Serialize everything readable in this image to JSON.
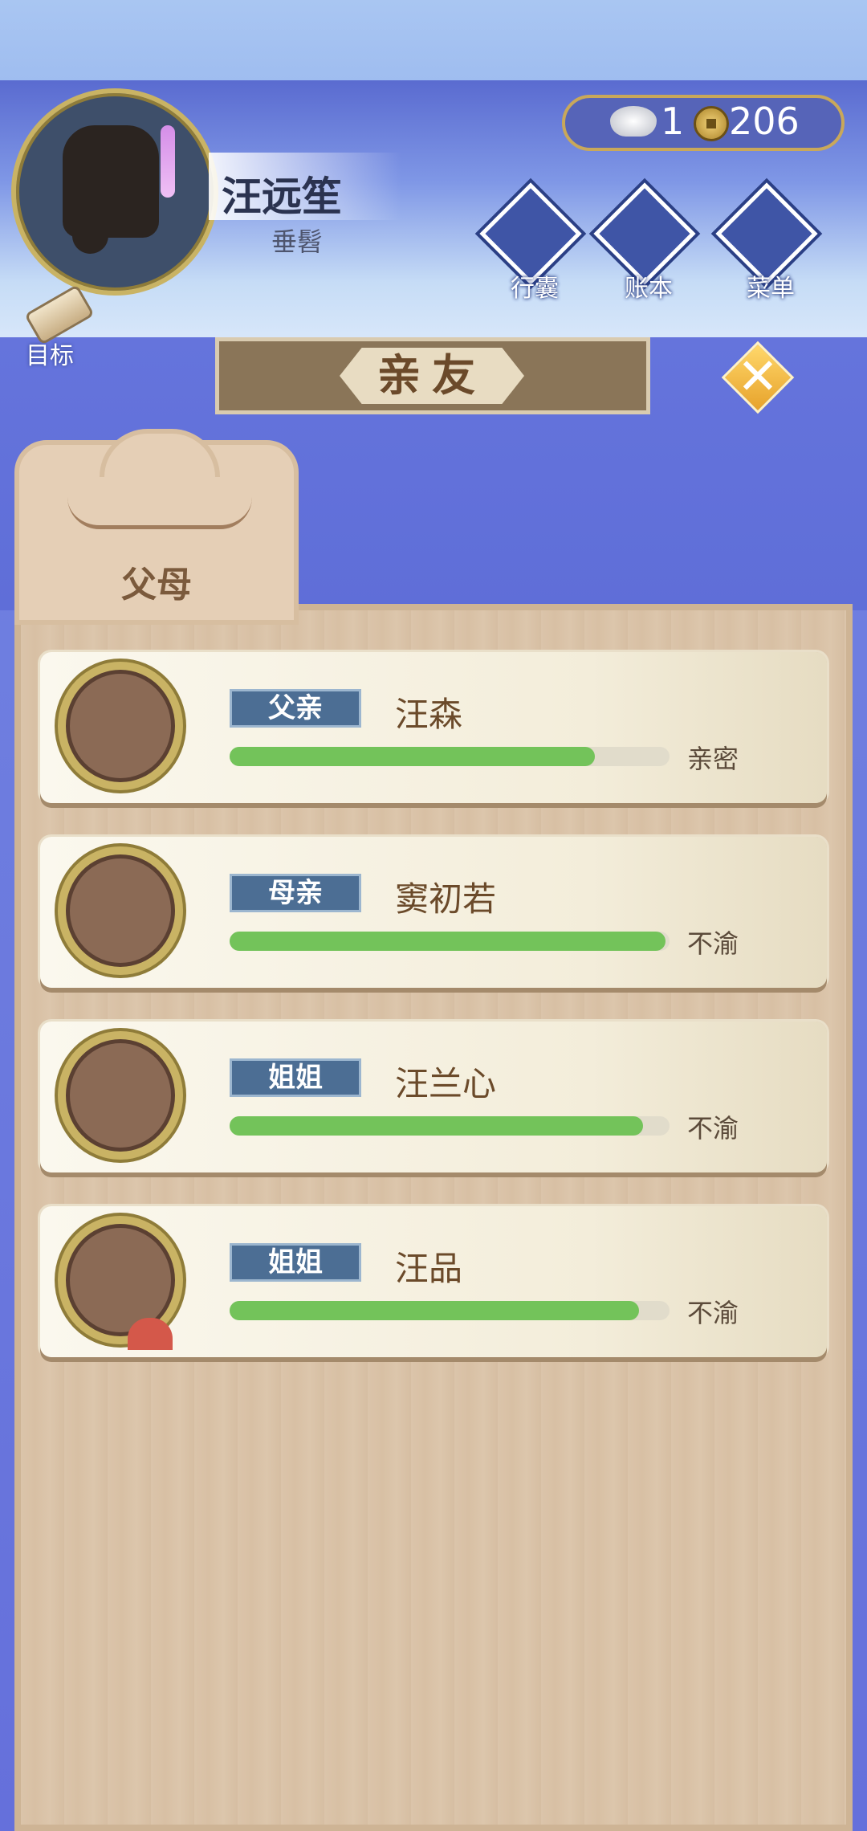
{
  "player": {
    "name": "汪远笙",
    "title": "垂髫"
  },
  "currency": {
    "silver": "1",
    "copper": "206"
  },
  "top_buttons": [
    {
      "label": "行囊",
      "icon": "bag-icon"
    },
    {
      "label": "账本",
      "icon": "ledger-icon"
    },
    {
      "label": "菜单",
      "icon": "menu-dots-icon"
    }
  ],
  "goal": {
    "label": "目标"
  },
  "page_title": "亲友",
  "tab": {
    "label": "父母"
  },
  "relatives": [
    {
      "relation": "父亲",
      "name": "汪森",
      "status": "亲密",
      "affinity": 0.83
    },
    {
      "relation": "母亲",
      "name": "窦初若",
      "status": "不渝",
      "affinity": 0.99
    },
    {
      "relation": "姐姐",
      "name": "汪兰心",
      "status": "不渝",
      "affinity": 0.94
    },
    {
      "relation": "姐姐",
      "name": "汪品",
      "status": "不渝",
      "affinity": 0.93
    }
  ],
  "colors": {
    "bar": "#73c35a",
    "relation_tag": "#4c6e94",
    "close_button": "#f2b53a"
  }
}
